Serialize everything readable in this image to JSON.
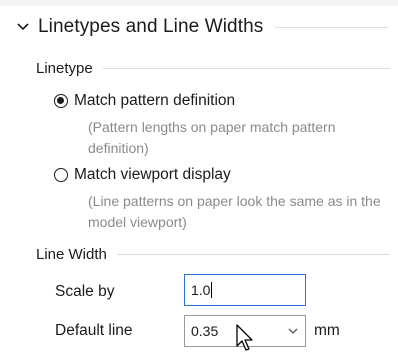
{
  "section": {
    "title": "Linetypes and Line Widths"
  },
  "linetype": {
    "label": "Linetype",
    "options": [
      {
        "label": "Match pattern definition",
        "description": "(Pattern lengths on paper match pattern definition)",
        "selected": true
      },
      {
        "label": "Match viewport display",
        "description": "(Line patterns on paper look the same as in the model viewport)",
        "selected": false
      }
    ]
  },
  "line_width": {
    "label": "Line Width",
    "scale_by": {
      "label": "Scale by",
      "value": "1.0"
    },
    "default_line": {
      "label": "Default line",
      "value": "0.35",
      "unit": "mm"
    }
  },
  "icons": {
    "section_toggle": "chevron-down-icon",
    "dropdown": "chevron-down-icon",
    "pointer": "mouse-cursor-icon"
  },
  "colors": {
    "focus_border": "#2b6fd6",
    "muted_text": "#8a8a8a"
  }
}
